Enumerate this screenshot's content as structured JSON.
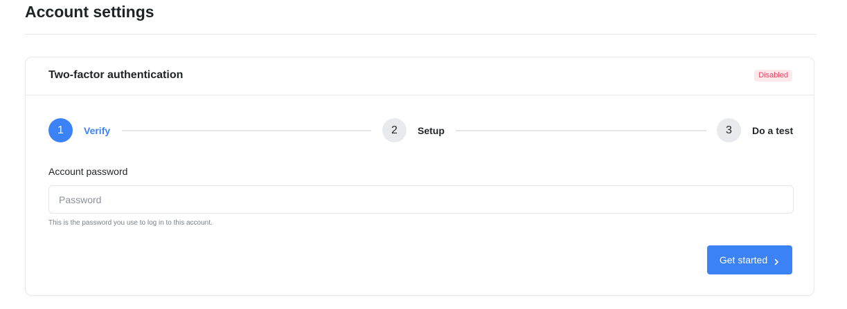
{
  "page": {
    "title": "Account settings"
  },
  "card": {
    "title": "Two-factor authentication",
    "status": "Disabled",
    "status_color": "#e0475f"
  },
  "stepper": {
    "active_color": "#3b82f6",
    "steps": [
      {
        "number": "1",
        "label": "Verify",
        "state": "active"
      },
      {
        "number": "2",
        "label": "Setup",
        "state": "inactive"
      },
      {
        "number": "3",
        "label": "Do a test",
        "state": "inactive"
      }
    ]
  },
  "form": {
    "password_label": "Account password",
    "password_value": "",
    "password_placeholder": "Password",
    "password_help": "This is the password you use to log in to this account."
  },
  "actions": {
    "primary_label": "Get started",
    "primary_icon": "chevron-right-icon"
  }
}
